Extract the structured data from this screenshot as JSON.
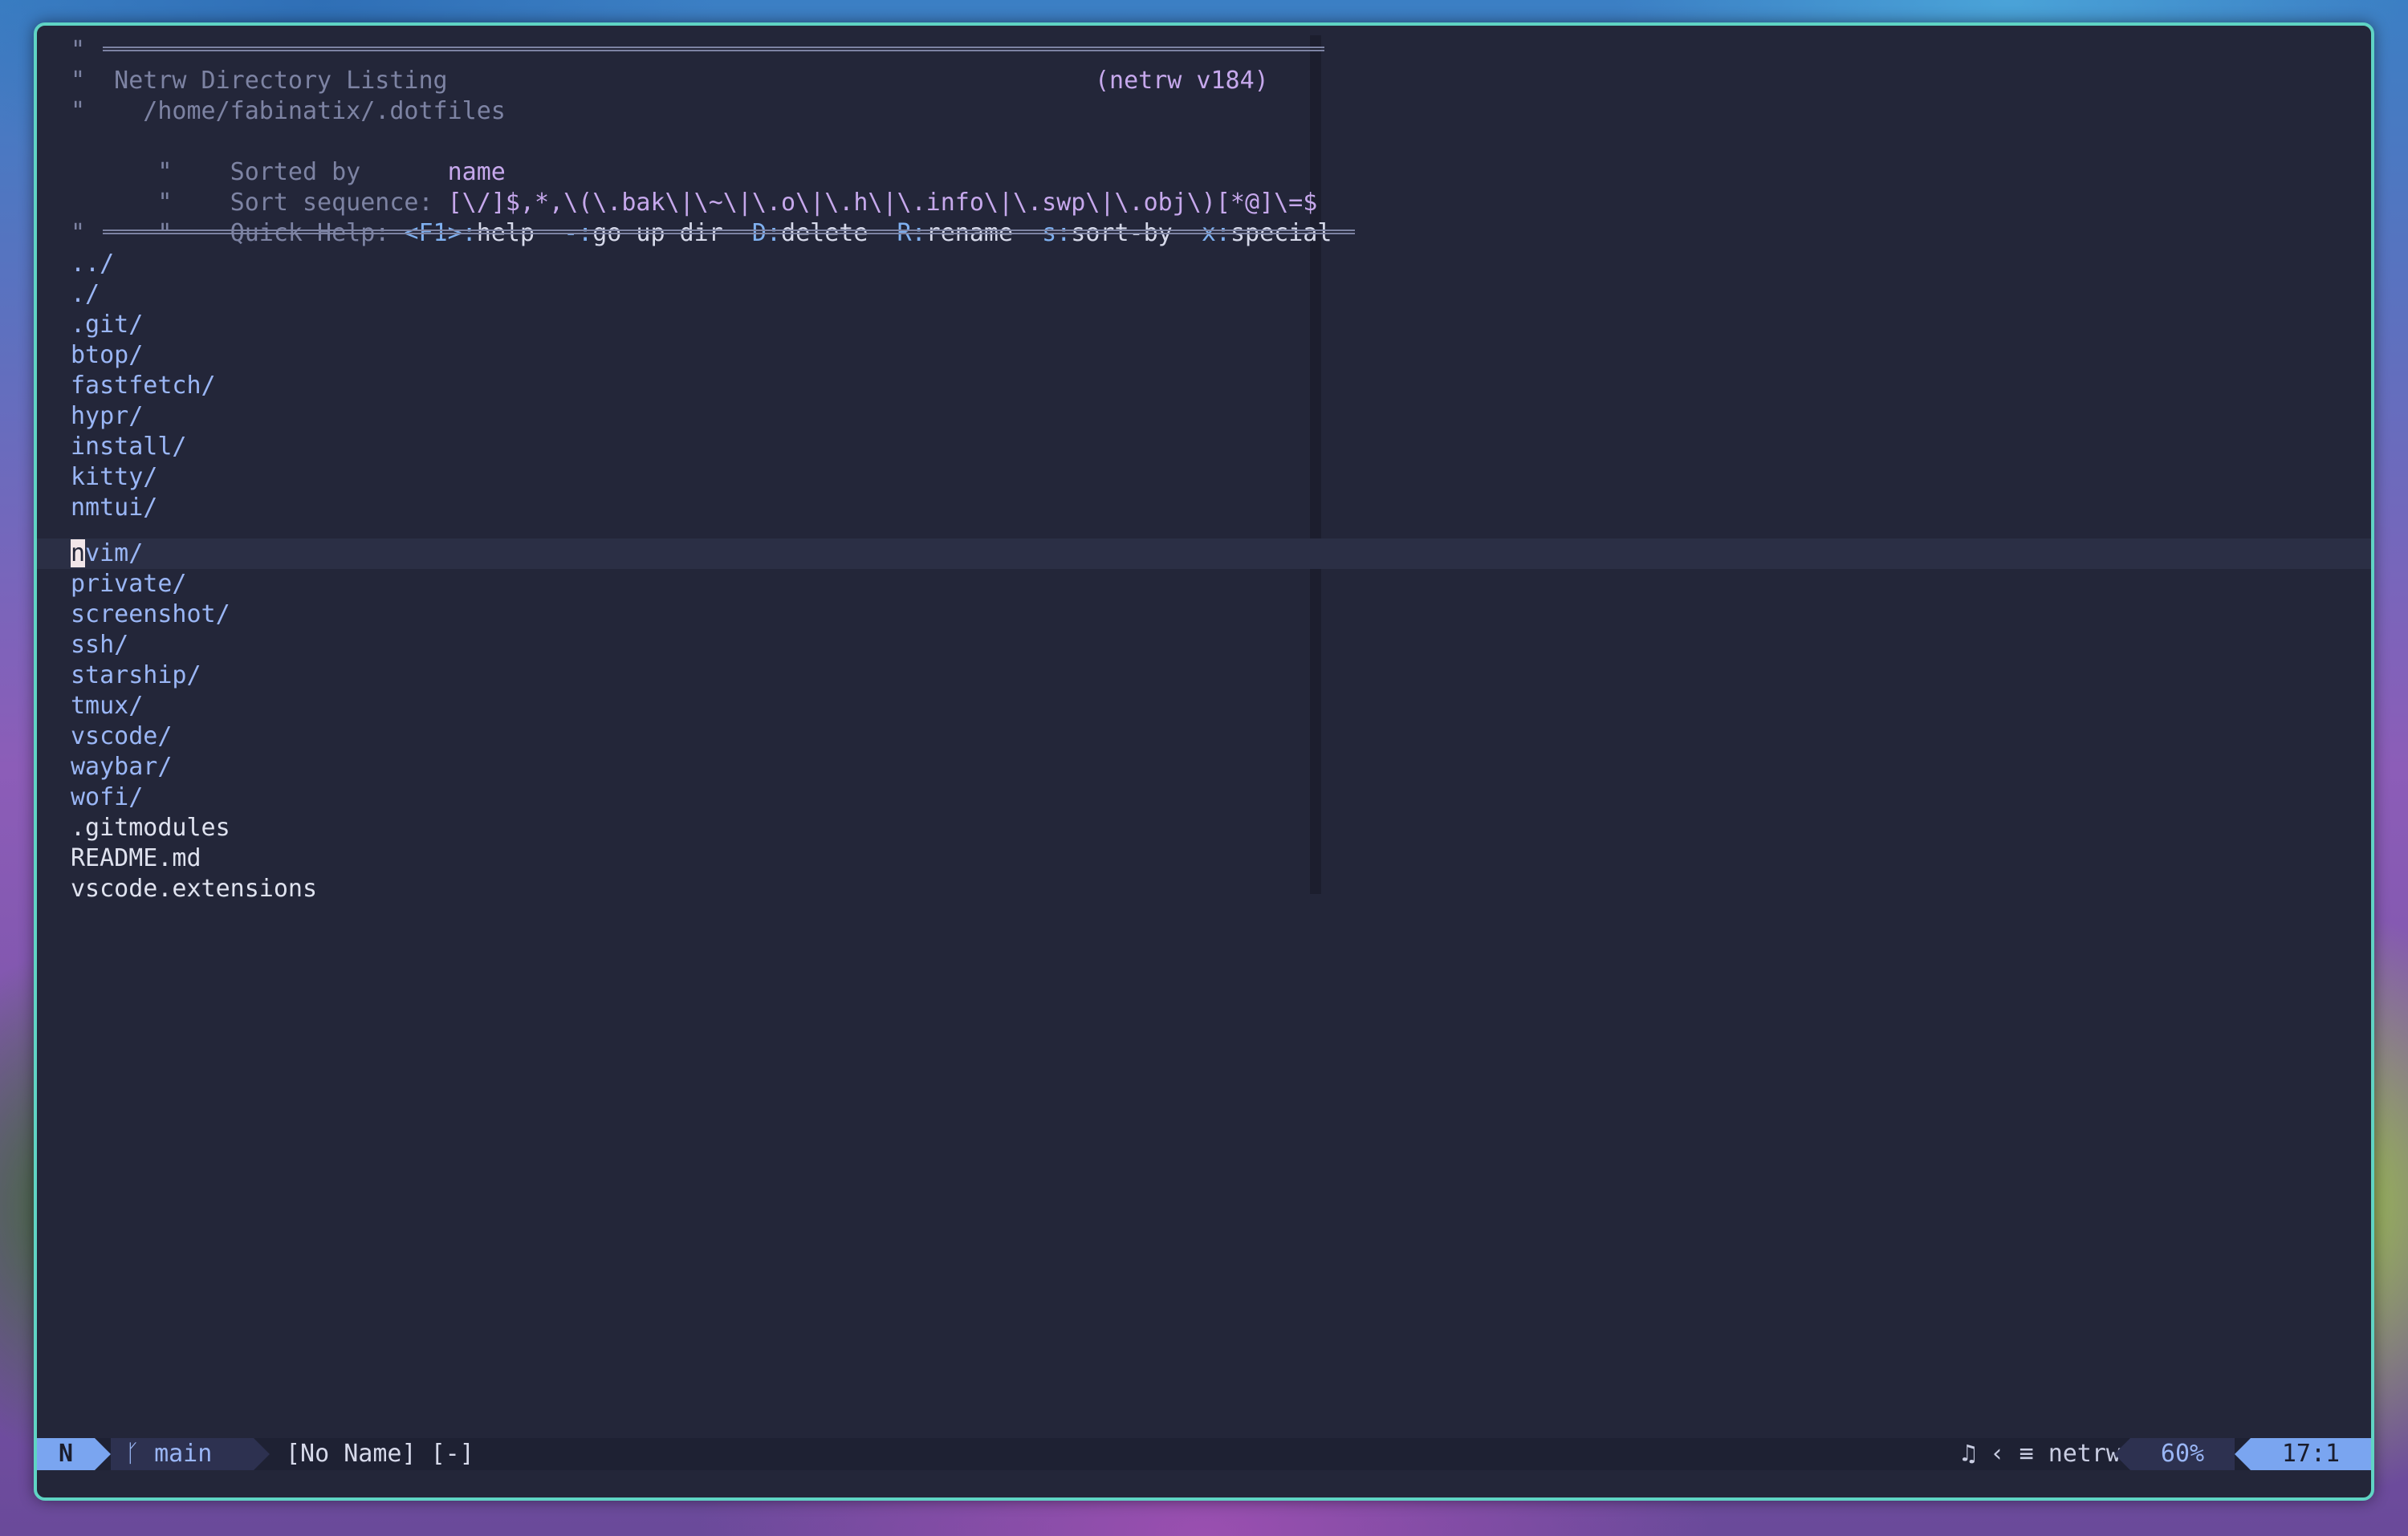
{
  "header": {
    "title_line": "\"  Netrw Directory Listing",
    "version": "(netrw v184)",
    "path_line": "\"    /home/fabinatix/.dotfiles",
    "sorted_label": "\"    Sorted by      ",
    "sorted_value": "name",
    "sequence_label": "\"    Sort sequence: ",
    "sequence_value": "[\\/]$,*,\\(\\.bak\\|\\~\\|\\.o\\|\\.h\\|\\.info\\|\\.swp\\|\\.obj\\)[*@]\\=$",
    "quickhelp_label": "\"    Quick Help: ",
    "quickhelp": [
      {
        "key": "<F1>:",
        "action": "help"
      },
      {
        "key": "-:",
        "action": "go up dir"
      },
      {
        "key": "D:",
        "action": "delete"
      },
      {
        "key": "R:",
        "action": "rename"
      },
      {
        "key": "s:",
        "action": "sort-by"
      },
      {
        "key": "x:",
        "action": "special"
      }
    ],
    "quote": "\""
  },
  "entries": [
    "../",
    "./",
    ".git/",
    "btop/",
    "fastfetch/",
    "hypr/",
    "install/",
    "kitty/",
    "nmtui/",
    "nvim/",
    "private/",
    "screenshot/",
    "ssh/",
    "starship/",
    "tmux/",
    "vscode/",
    "waybar/",
    "wofi/",
    ".gitmodules",
    "README.md",
    "vscode.extensions"
  ],
  "cursor": {
    "entry": "nvim/",
    "char": "n",
    "rest": "vim/"
  },
  "statusline": {
    "mode": "N",
    "branch_icon": "ᚴ",
    "branch": "main",
    "buffer": "[No Name] [-]",
    "filetype_icons": "♫ ‹ ≡",
    "filetype": "netrw",
    "percent": "60%",
    "position": "17:1"
  }
}
